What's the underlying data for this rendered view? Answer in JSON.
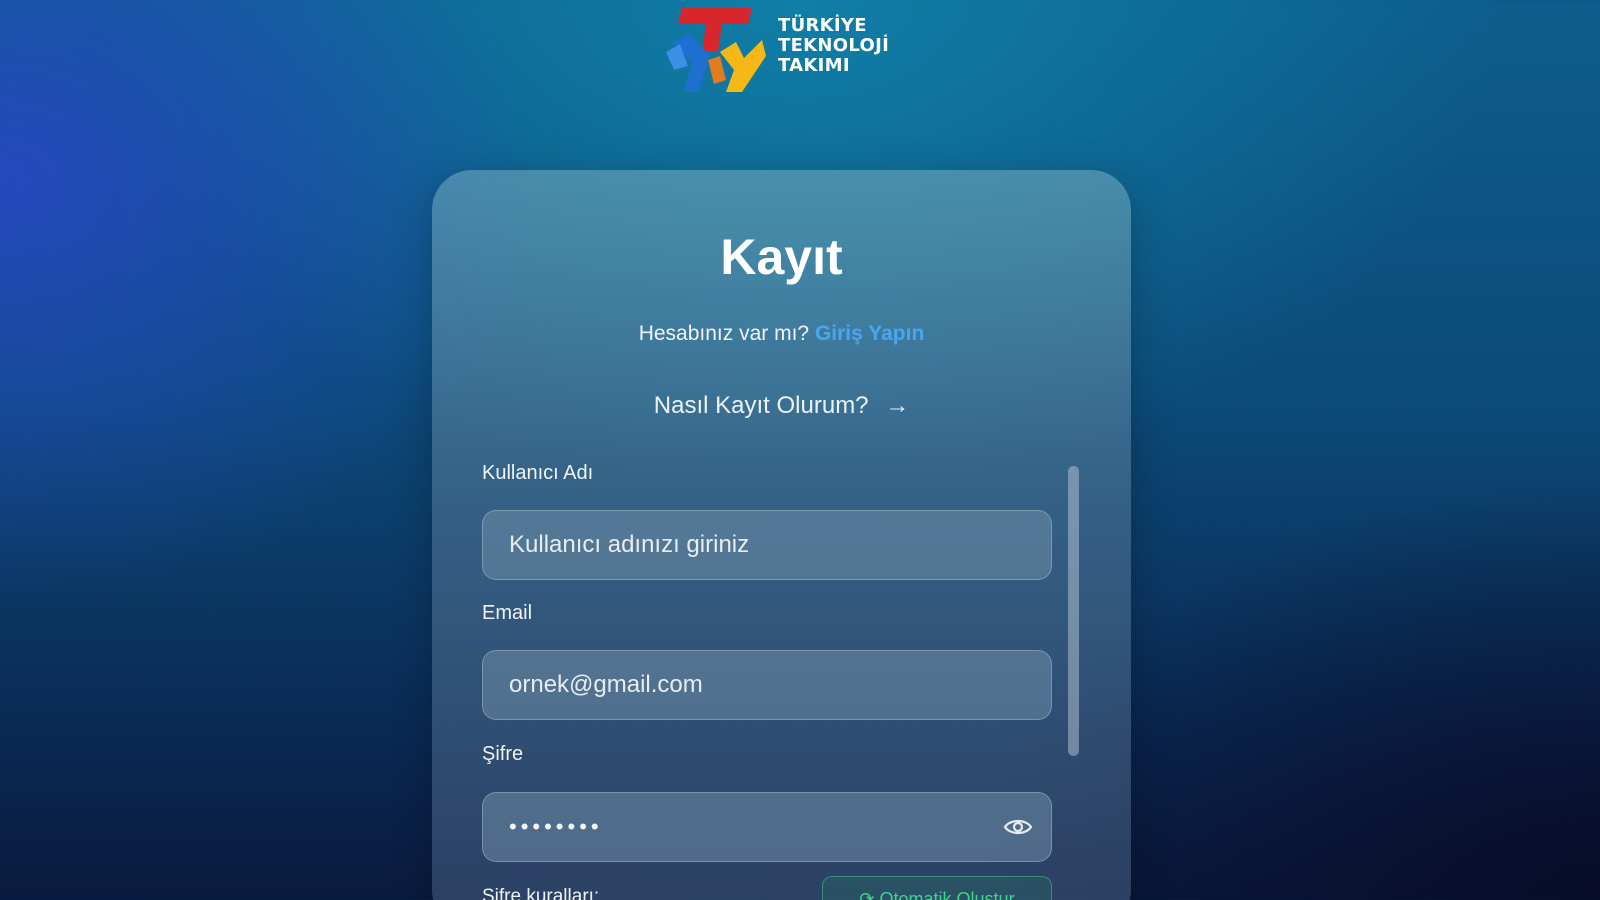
{
  "logo": {
    "line1": "TÜRKİYE",
    "line2": "TEKNOLOJİ",
    "line3": "TAKIMI"
  },
  "form": {
    "title": "Kayıt",
    "have_account_text": "Hesabınız var mı?",
    "login_link": "Giriş Yapın",
    "howto_link": "Nasıl Kayıt Olurum?",
    "username": {
      "label": "Kullanıcı Adı",
      "placeholder": "Kullanıcı adınızı giriniz"
    },
    "email": {
      "label": "Email",
      "placeholder": "ornek@gmail.com"
    },
    "password": {
      "label": "Şifre",
      "value": "••••••••"
    },
    "password_rules_label": "Şifre kuralları:",
    "auto_generate_button": "Otomatik Oluştur"
  },
  "colors": {
    "link": "#4aa6f0",
    "auto_button": "#3fd38e",
    "logo_red": "#d8262e",
    "logo_yellow": "#f5b816",
    "logo_blue": "#1e6fd0"
  }
}
